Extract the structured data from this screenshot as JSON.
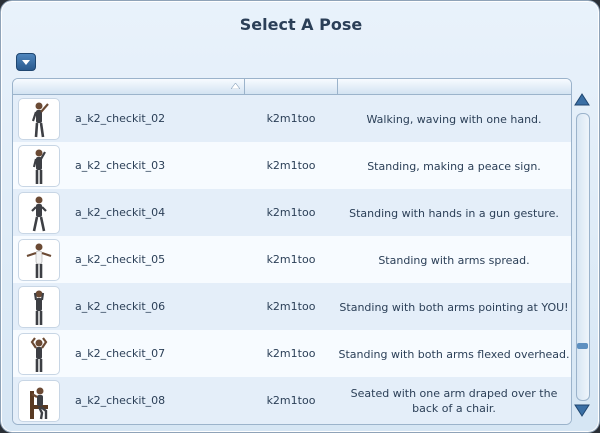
{
  "dialog": {
    "title": "Select A Pose"
  },
  "colors": {
    "accent": "#3a6fa4",
    "text": "#2b3f57",
    "row_alt": "#e4eef9"
  },
  "list": {
    "rows": [
      {
        "name": "a_k2_checkit_02",
        "creator": "k2m1too",
        "description": "Walking, waving with one hand.",
        "icon": "pose-thumbnail"
      },
      {
        "name": "a_k2_checkit_03",
        "creator": "k2m1too",
        "description": "Standing, making a peace sign.",
        "icon": "pose-thumbnail"
      },
      {
        "name": "a_k2_checkit_04",
        "creator": "k2m1too",
        "description": "Standing with hands in a gun gesture.",
        "icon": "pose-thumbnail"
      },
      {
        "name": "a_k2_checkit_05",
        "creator": "k2m1too",
        "description": "Standing with arms spread.",
        "icon": "pose-thumbnail"
      },
      {
        "name": "a_k2_checkit_06",
        "creator": "k2m1too",
        "description": "Standing with both arms pointing at YOU!",
        "icon": "pose-thumbnail"
      },
      {
        "name": "a_k2_checkit_07",
        "creator": "k2m1too",
        "description": "Standing with both arms flexed overhead.",
        "icon": "pose-thumbnail"
      },
      {
        "name": "a_k2_checkit_08",
        "creator": "k2m1too",
        "description": "Seated with one arm draped over the back of a chair.",
        "icon": "pose-thumbnail"
      }
    ]
  },
  "icons": {
    "dropdown": "chevron-down-icon",
    "sort": "sort-ascending-icon",
    "scroll_up": "scroll-up-arrow-icon",
    "scroll_down": "scroll-down-arrow-icon"
  }
}
